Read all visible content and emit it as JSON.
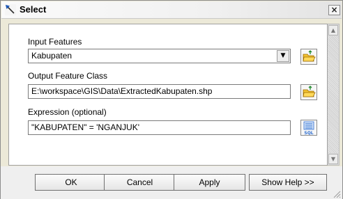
{
  "window": {
    "title": "Select"
  },
  "icons": {
    "title": "select-tool-icon",
    "close": "close-icon",
    "browse": "folder-open-icon",
    "sql": "sql-query-icon",
    "dropdown": "chevron-down-icon",
    "scroll_up": "scroll-up-arrow-icon",
    "scroll_down": "scroll-down-arrow-icon",
    "resize": "resize-grip-icon"
  },
  "close_label": "×",
  "sql_label": "SQL",
  "dropdown_glyph": "▼",
  "scroll_up_glyph": "▲",
  "scroll_down_glyph": "▼",
  "form": {
    "input_features_label": "Input Features",
    "input_features_value": "Kabupaten",
    "output_label": "Output Feature Class",
    "output_value": "E:\\workspace\\GIS\\Data\\ExtractedKabupaten.shp",
    "expression_label": "Expression (optional)",
    "expression_value": "\"KABUPATEN\" = 'NGANJUK'"
  },
  "buttons": {
    "ok": "OK",
    "cancel": "Cancel",
    "apply": "Apply",
    "show_help": "Show Help >>"
  },
  "colors": {
    "title_accent": "#1b57b8",
    "folder_yellow": "#f2c230",
    "sql_blue": "#2f6fd0"
  }
}
